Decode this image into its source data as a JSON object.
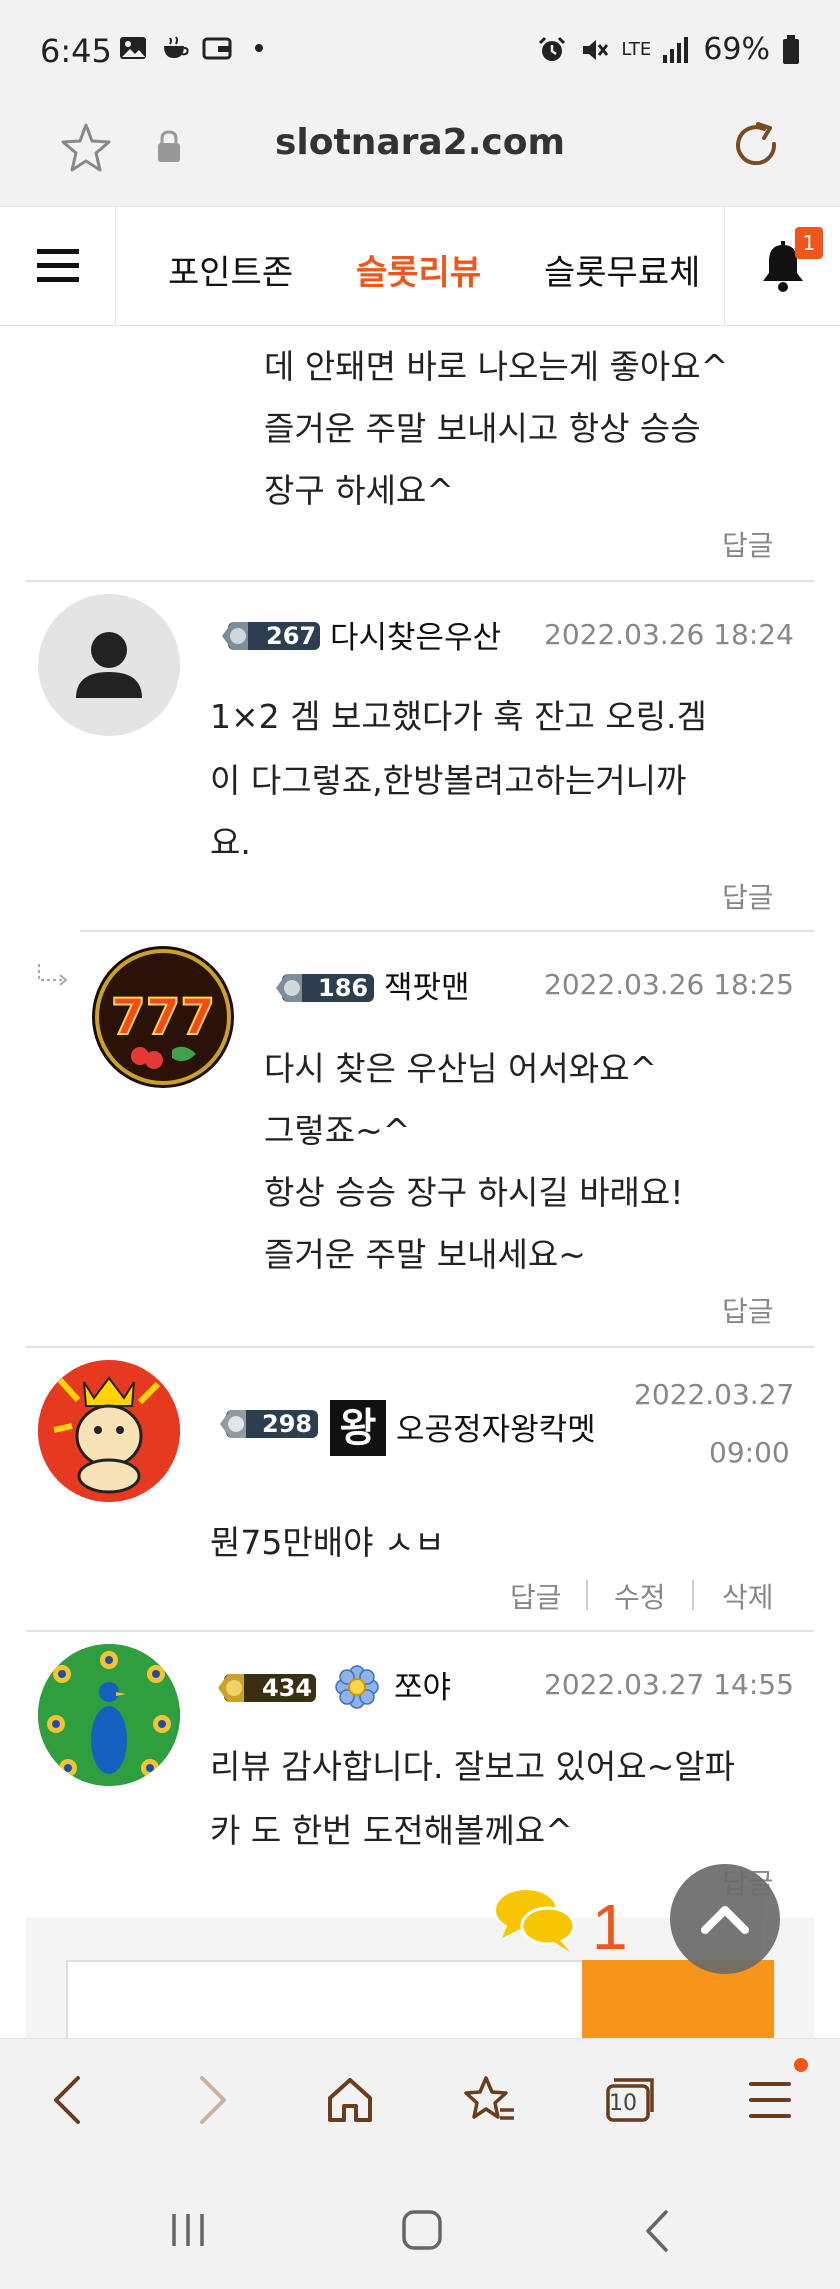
{
  "status_bar": {
    "time": "6:45",
    "battery": "69%",
    "network": "LTE",
    "icons": [
      "image-icon",
      "teacup-icon",
      "wallet-icon",
      "dot-icon",
      "alarm-icon",
      "mute-icon",
      "signal-icon",
      "battery-icon"
    ]
  },
  "address_bar": {
    "url": "slotnara2.com"
  },
  "site_nav": {
    "tabs": [
      {
        "label": "포인트존",
        "active": false
      },
      {
        "label": "슬롯리뷰",
        "active": true
      },
      {
        "label": "슬롯무료체",
        "active": false
      }
    ],
    "notification_count": "1"
  },
  "comments": [
    {
      "partial": true,
      "lines": [
        "데 안돼면 바로 나오는게 좋아요^",
        "즐거운 주말 보내시고 항상 승승",
        "장구 하세요^"
      ],
      "actions": [
        "답글"
      ]
    },
    {
      "level": "267",
      "nickname": "다시찾은우산",
      "date": "2022.03.26 18:24",
      "lines": [
        "1×2  겜 보고했다가 훅 잔고 오링.겜",
        "이 다그렇죠,한방볼려고하는거니까",
        "요."
      ],
      "actions": [
        "답글"
      ]
    },
    {
      "is_reply": true,
      "level": "186",
      "nickname": "잭팟맨",
      "date": "2022.03.26 18:25",
      "lines": [
        "다시 찾은 우산님 어서와요^",
        "그렇죠~^",
        "항상 승승 장구 하시길 바래요!",
        "즐거운 주말 보내세요~"
      ],
      "actions": [
        "답글"
      ]
    },
    {
      "level": "298",
      "badge_char": "왕",
      "nickname": "오공정자왕칵멧",
      "date_line1": "2022.03.27",
      "date_line2": "09:00",
      "lines": [
        "뭔75만배야 ㅅㅂ"
      ],
      "actions": [
        "답글",
        "수정",
        "삭제"
      ]
    },
    {
      "level": "434",
      "nickname": "쪼야",
      "date": "2022.03.27 14:55",
      "lines": [
        "리뷰 감사합니다. 잘보고 있어요~알파",
        "카 도 한번 도전해볼께요^"
      ],
      "actions": [
        "답글"
      ]
    }
  ],
  "floating": {
    "comment_count": "1"
  },
  "toolbar": {
    "tab_count": "10"
  },
  "colors": {
    "accent": "#f0561b",
    "orange_button": "#f6951a",
    "meta_gray": "#888888"
  }
}
